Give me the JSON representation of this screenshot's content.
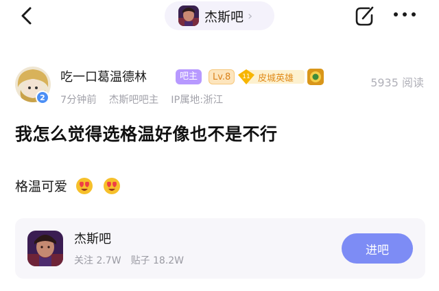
{
  "header": {
    "back_icon": "back-chevron-icon",
    "forum_name": "杰斯吧",
    "forum_chevron": "›",
    "share_icon": "share-edit-icon",
    "more_icon": "more-dots-icon"
  },
  "author": {
    "name": "吃一口葛温德林",
    "badge_number": "2",
    "tags": {
      "owner": "吧主",
      "level": "Lv.8",
      "hero_level": "11",
      "hero_title": "皮城英雄"
    },
    "time": "7分钟前",
    "role": "杰斯吧吧主",
    "ip": "IP属地:浙江",
    "views": "5935 阅读"
  },
  "post": {
    "title": "我怎么觉得选格温好像也不是不行",
    "body": "格温可爱",
    "emojis": [
      "heart-eyes-emoji",
      "heart-eyes-emoji"
    ]
  },
  "forum_card": {
    "name": "杰斯吧",
    "followers": "关注 2.7W",
    "posts": "贴子 18.2W",
    "enter_label": "进吧"
  },
  "colors": {
    "accent": "#7d8cf5",
    "owner_tag": "#b799ff",
    "level_tag": "#d9801a",
    "hero_tag": "#e08a1a",
    "muted_text": "#a2a2aa",
    "card_bg": "#f7f6fa"
  }
}
